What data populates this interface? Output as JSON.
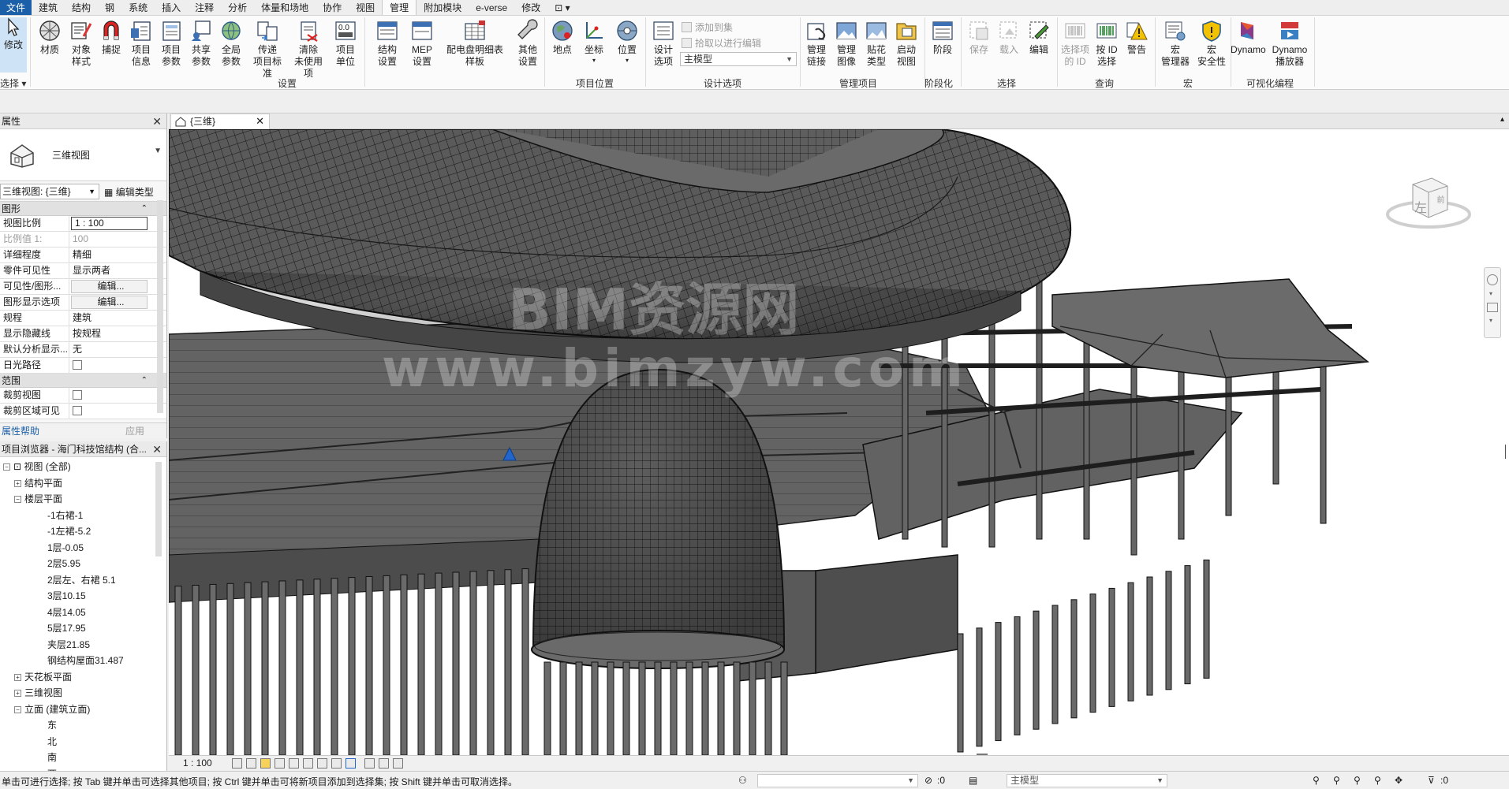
{
  "menu": {
    "tabs": [
      "文件",
      "建筑",
      "结构",
      "钢",
      "系统",
      "插入",
      "注释",
      "分析",
      "体量和场地",
      "协作",
      "视图",
      "管理",
      "附加模块",
      "e-verse",
      "修改",
      "⊡ ▾"
    ],
    "active_index": 11
  },
  "ribbon": {
    "buttons": {
      "modify": "修改",
      "materials": "材质",
      "object_styles": "对象\n样式",
      "snaps": "捕捉",
      "project_info": "项目\n信息",
      "project_params": "项目\n参数",
      "shared_params": "共享\n参数",
      "global_params": "全局\n参数",
      "transfer_standards": "传递\n项目标准",
      "purge_unused": "清除\n未使用项",
      "project_units": "项目\n单位",
      "structural_settings": "结构\n设置",
      "mep_settings": "MEP\n设置",
      "panel_schedule": "配电盘明细表\n样板",
      "other_settings": "其他\n设置",
      "location": "地点",
      "coordinates": "坐标",
      "position": "位置",
      "design_options": "设计\n选项",
      "manage_links": "管理\n链接",
      "manage_images": "管理\n图像",
      "decal_types": "贴花\n类型",
      "starting_view": "启动\n视图",
      "phases": "阶段",
      "save_selection": "保存",
      "load_selection": "载入",
      "edit_selection": "编辑",
      "ids_of_selection": "选择项\n的 ID",
      "select_by_id": "按 ID\n选择",
      "warnings": "警告",
      "macro_manager": "宏\n管理器",
      "macro_security": "宏\n安全性",
      "dynamo": "Dynamo",
      "dynamo_player": "Dynamo\n播放器"
    },
    "design_option_commands": {
      "add_to_set": "添加到集",
      "pick_to_edit": "拾取以进行编辑",
      "main_model": "主模型"
    },
    "panels": {
      "select": "选择 ▾",
      "settings": "设置",
      "project_location": "项目位置",
      "design_options": "设计选项",
      "manage_project": "管理项目",
      "phasing": "阶段化",
      "selection": "选择",
      "inquiry": "查询",
      "macros": "宏",
      "visual_programming": "可视化编程"
    }
  },
  "properties": {
    "title": "属性",
    "type_name": "三维视图",
    "instance_selector": "三维视图: {三维}",
    "edit_type": "编辑类型",
    "group_graphics": "图形",
    "rows": [
      {
        "k": "视图比例",
        "v": "1 : 100",
        "style": "boxed"
      },
      {
        "k": "比例值 1:",
        "v": "100",
        "style": "gray"
      },
      {
        "k": "详细程度",
        "v": "精细",
        "style": ""
      },
      {
        "k": "零件可见性",
        "v": "显示两者",
        "style": ""
      },
      {
        "k": "可见性/图形...",
        "v": "编辑...",
        "style": "btn"
      },
      {
        "k": "图形显示选项",
        "v": "编辑...",
        "style": "btn"
      },
      {
        "k": "规程",
        "v": "建筑",
        "style": ""
      },
      {
        "k": "显示隐藏线",
        "v": "按规程",
        "style": ""
      },
      {
        "k": "默认分析显示...",
        "v": "无",
        "style": ""
      },
      {
        "k": "日光路径",
        "v": "",
        "style": "check"
      }
    ],
    "group_extents": "范围",
    "extent_rows": [
      {
        "k": "裁剪视图",
        "v": "",
        "style": "check"
      },
      {
        "k": "裁剪区域可见",
        "v": "",
        "style": "check"
      }
    ],
    "help_link": "属性帮助",
    "apply_button": "应用"
  },
  "browser": {
    "title": "项目浏览器 - 海门科技馆结构 (合...",
    "items": [
      {
        "label": "视图 (全部)",
        "level": 0,
        "exp": "−",
        "icon": true
      },
      {
        "label": "结构平面",
        "level": 1,
        "exp": "+"
      },
      {
        "label": "楼层平面",
        "level": 1,
        "exp": "−"
      },
      {
        "label": "-1右裙-1",
        "level": 2
      },
      {
        "label": "-1左裙-5.2",
        "level": 2
      },
      {
        "label": "1层-0.05",
        "level": 2
      },
      {
        "label": "2层5.95",
        "level": 2
      },
      {
        "label": "2层左、右裙 5.1",
        "level": 2
      },
      {
        "label": "3层10.15",
        "level": 2
      },
      {
        "label": "4层14.05",
        "level": 2
      },
      {
        "label": "5层17.95",
        "level": 2
      },
      {
        "label": "夹层21.85",
        "level": 2
      },
      {
        "label": "钢结构屋面31.487",
        "level": 2
      },
      {
        "label": "天花板平面",
        "level": 1,
        "exp": "+"
      },
      {
        "label": "三维视图",
        "level": 1,
        "exp": "+"
      },
      {
        "label": "立面 (建筑立面)",
        "level": 1,
        "exp": "−"
      },
      {
        "label": "东",
        "level": 2
      },
      {
        "label": "北",
        "level": 2
      },
      {
        "label": "南",
        "level": 2
      },
      {
        "label": "西",
        "level": 2
      }
    ]
  },
  "view_tab": {
    "label": "{三维}"
  },
  "viewcube": {
    "face": "左",
    "side": "前"
  },
  "watermark": {
    "line1": "BIM资源网",
    "line2": "www.bimzyw.com"
  },
  "view_control": {
    "scale": "1 : 100"
  },
  "status": {
    "hint": "单击可进行选择; 按 Tab 键并单击可选择其他项目; 按 Ctrl 键并单击可将新项目添加到选择集; 按 Shift 键并单击可取消选择。",
    "zero": ":0",
    "model": "主模型",
    "filter_count": ":0"
  },
  "colors": {
    "file_tab": "#1b5fa8",
    "model_fill": "#5f5f5f",
    "mesh_line": "#101010",
    "background": "#ffffff"
  }
}
